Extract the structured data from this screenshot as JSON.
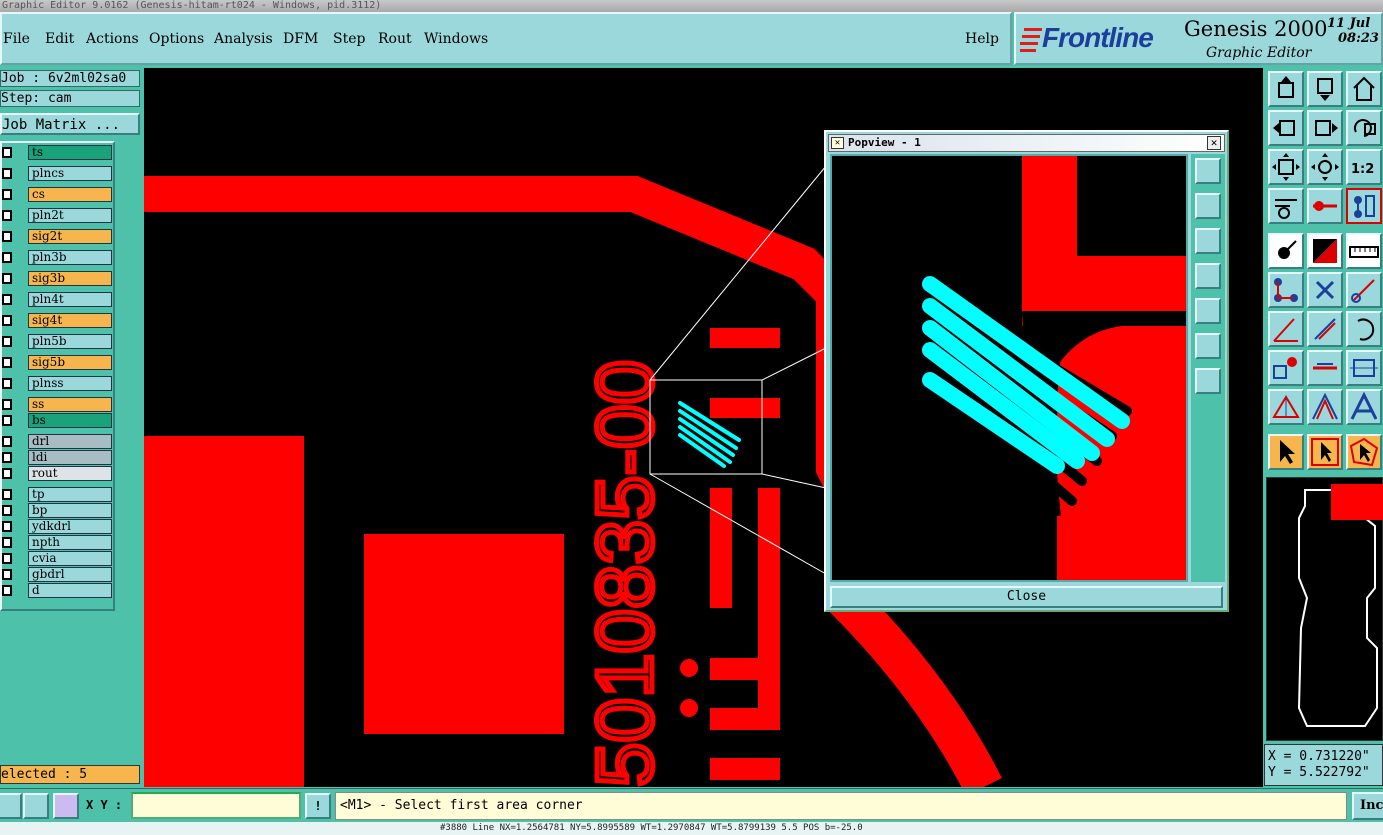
{
  "window": {
    "title": "Graphic Editor 9.0162 (Genesis-hitam-rt024 - Windows, pid.3112)"
  },
  "menu": {
    "file": "File",
    "edit": "Edit",
    "actions": "Actions",
    "options": "Options",
    "analysis": "Analysis",
    "dfm": "DFM",
    "step": "Step",
    "rout": "Rout",
    "windows": "Windows",
    "help": "Help"
  },
  "brand": {
    "logo": "Frontline",
    "product": "Genesis 2000",
    "module": "Graphic Editor",
    "date": "11 Jul",
    "time": "08:23"
  },
  "job": {
    "job_label": "Job : 6v2ml02sa0",
    "step_label": "Step: cam",
    "matrix_button": "Job Matrix ..."
  },
  "layers": [
    {
      "name": "ts",
      "color": "#1aa37a"
    },
    {
      "name": "plncs",
      "color": "#9bd8db"
    },
    {
      "name": "cs",
      "color": "#f7b64d"
    },
    {
      "name": "pln2t",
      "color": "#9bd8db"
    },
    {
      "name": "sig2t",
      "color": "#f7b64d"
    },
    {
      "name": "pln3b",
      "color": "#9bd8db"
    },
    {
      "name": "sig3b",
      "color": "#f7b64d"
    },
    {
      "name": "pln4t",
      "color": "#9bd8db"
    },
    {
      "name": "sig4t",
      "color": "#f7b64d"
    },
    {
      "name": "pln5b",
      "color": "#9bd8db"
    },
    {
      "name": "sig5b",
      "color": "#f7b64d"
    },
    {
      "name": "plnss",
      "color": "#9bd8db"
    },
    {
      "name": "ss",
      "color": "#f7b64d"
    },
    {
      "name": "bs",
      "color": "#1aa37a"
    },
    {
      "name": "drl",
      "color": "#a8bcc4"
    },
    {
      "name": "ldi",
      "color": "#a8bcc4"
    },
    {
      "name": "rout",
      "color": "#dde3e6"
    },
    {
      "name": "tp",
      "color": "#9bd8db"
    },
    {
      "name": "bp",
      "color": "#9bd8db"
    },
    {
      "name": "ydkdrl",
      "color": "#9bd8db"
    },
    {
      "name": "npth",
      "color": "#9bd8db"
    },
    {
      "name": "cvia",
      "color": "#9bd8db"
    },
    {
      "name": "gbdrl",
      "color": "#9bd8db"
    },
    {
      "name": "d",
      "color": "#9bd8db"
    }
  ],
  "selected": {
    "label": "elected : 5"
  },
  "canvas": {
    "board_text": "5010835-00"
  },
  "popview": {
    "title": "Popview - 1",
    "close_label": "Close"
  },
  "coords": {
    "x_line": "X = 0.731220\"",
    "y_line": "Y = 5.522792\""
  },
  "bottom": {
    "xy_label": "X Y :",
    "xy_value": "",
    "prompt": "<M1> - Select first area corner",
    "inc_label": "Inc"
  },
  "status": {
    "text": "#3880 Line NX=1.2564781 NY=5.8995589 WT=1.2970847 WT=5.8799139 5.5 POS b=-25.0"
  }
}
